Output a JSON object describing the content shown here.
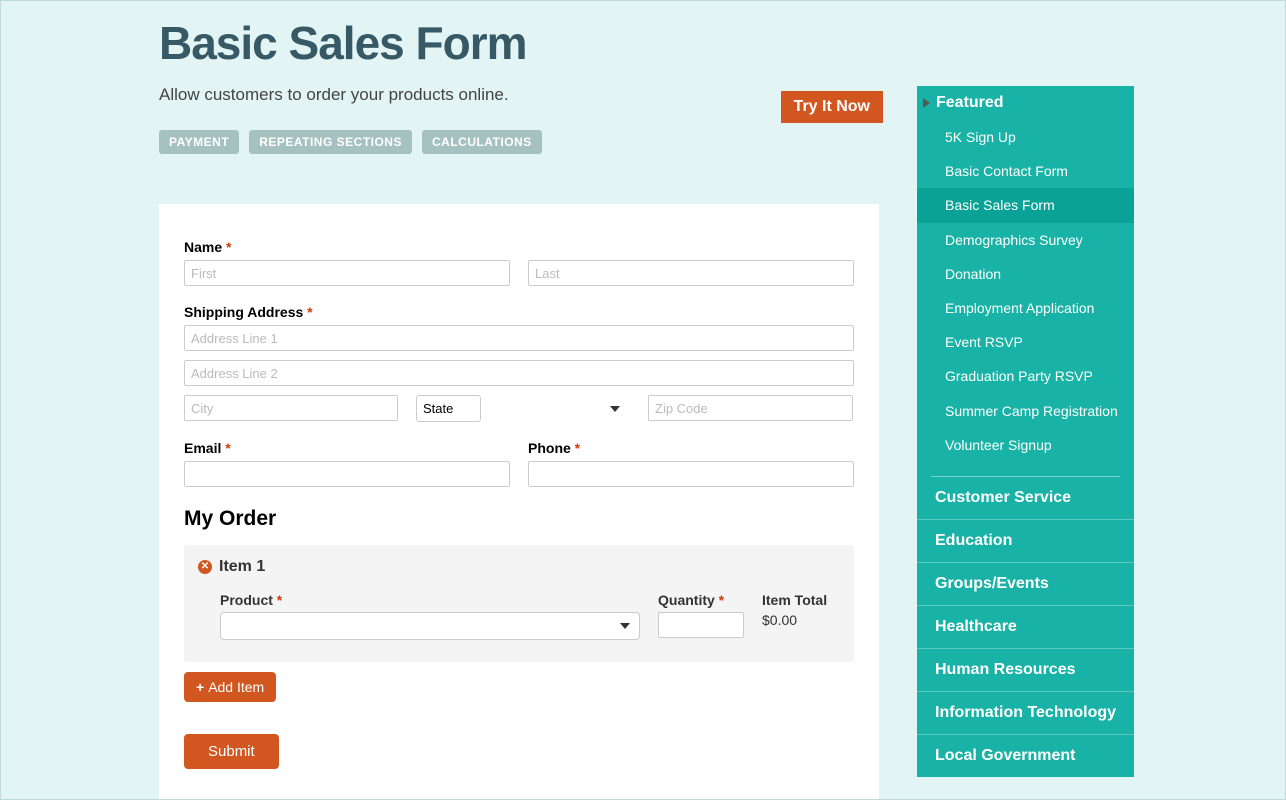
{
  "page": {
    "title": "Basic Sales Form",
    "description": "Allow customers to order your products online.",
    "try_button": "Try It Now"
  },
  "tags": [
    "PAYMENT",
    "REPEATING SECTIONS",
    "CALCULATIONS"
  ],
  "form": {
    "name_label": "Name",
    "first_placeholder": "First",
    "last_placeholder": "Last",
    "shipping_label": "Shipping Address",
    "addr1_placeholder": "Address Line 1",
    "addr2_placeholder": "Address Line 2",
    "city_placeholder": "City",
    "state_default": "State",
    "zip_placeholder": "Zip Code",
    "email_label": "Email",
    "phone_label": "Phone",
    "order_heading": "My Order",
    "item": {
      "title": "Item 1",
      "product_label": "Product",
      "quantity_label": "Quantity",
      "total_label": "Item Total",
      "total_value": "$0.00"
    },
    "add_item_label": "Add Item",
    "submit_label": "Submit"
  },
  "sidebar": {
    "featured_header": "Featured",
    "featured_items": [
      {
        "label": "5K Sign Up",
        "active": false
      },
      {
        "label": "Basic Contact Form",
        "active": false
      },
      {
        "label": "Basic Sales Form",
        "active": true
      },
      {
        "label": "Demographics Survey",
        "active": false
      },
      {
        "label": "Donation",
        "active": false
      },
      {
        "label": "Employment Application",
        "active": false
      },
      {
        "label": "Event RSVP",
        "active": false
      },
      {
        "label": "Graduation Party RSVP",
        "active": false
      },
      {
        "label": "Summer Camp Registration",
        "active": false
      },
      {
        "label": "Volunteer Signup",
        "active": false
      }
    ],
    "categories": [
      "Customer Service",
      "Education",
      "Groups/Events",
      "Healthcare",
      "Human Resources",
      "Information Technology",
      "Local Government"
    ]
  }
}
